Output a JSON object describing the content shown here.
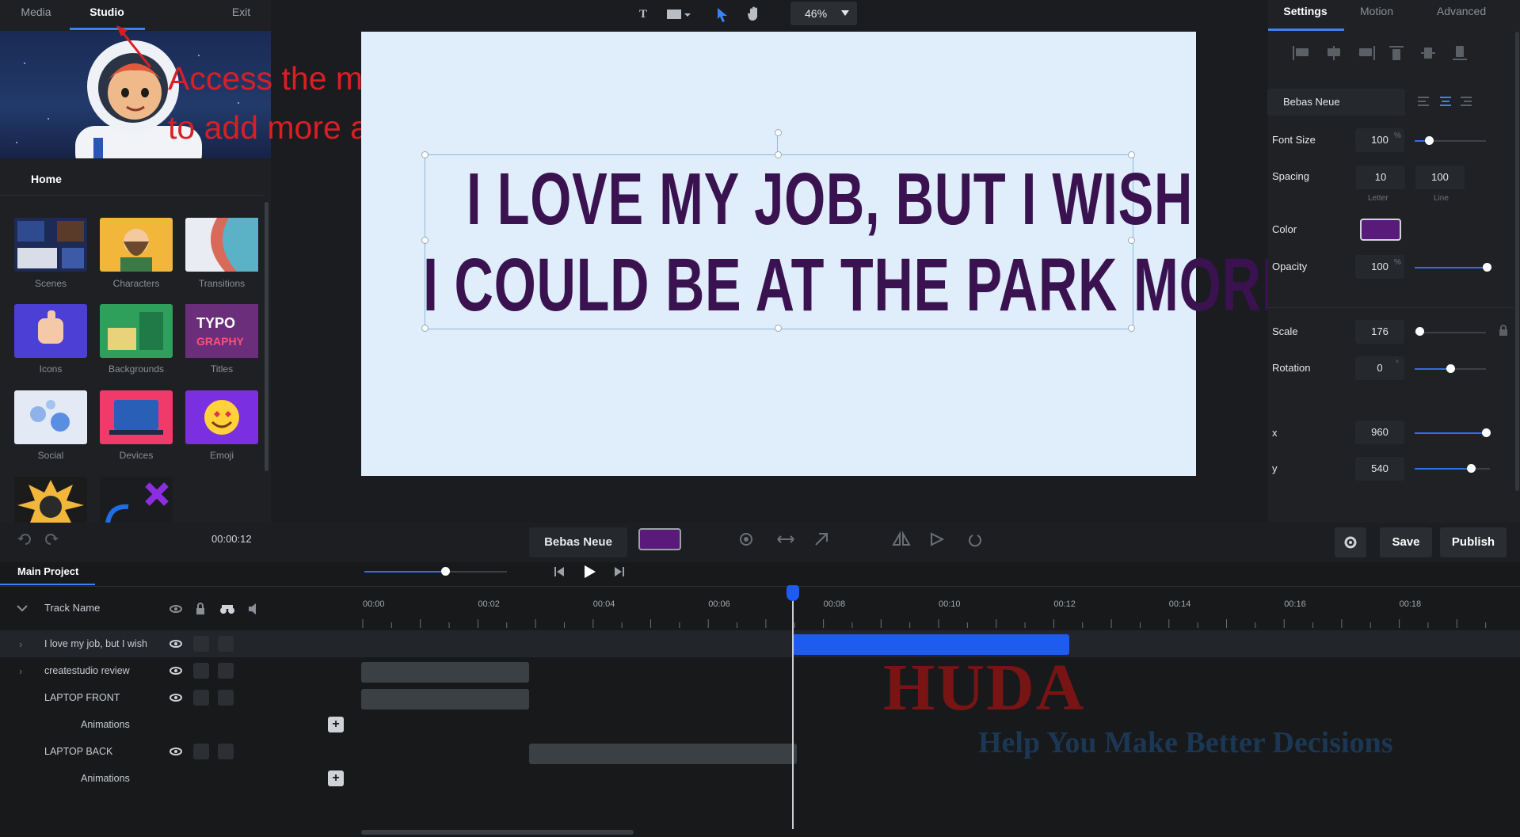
{
  "left_panel": {
    "tabs": [
      {
        "label": "Media",
        "active": false
      },
      {
        "label": "Studio",
        "active": true
      },
      {
        "label": "Exit",
        "active": false
      }
    ],
    "home_label": "Home",
    "categories": [
      {
        "label": "Scenes",
        "icon": "scenes-icon"
      },
      {
        "label": "Characters",
        "icon": "characters-icon"
      },
      {
        "label": "Transitions",
        "icon": "transitions-icon"
      },
      {
        "label": "Icons",
        "icon": "icons-icon"
      },
      {
        "label": "Backgrounds",
        "icon": "backgrounds-icon"
      },
      {
        "label": "Titles",
        "icon": "titles-icon"
      },
      {
        "label": "Social",
        "icon": "social-icon"
      },
      {
        "label": "Devices",
        "icon": "devices-icon"
      },
      {
        "label": "Emoji",
        "icon": "emoji-icon"
      }
    ],
    "thumb_typo_text": "TYPO GRAPHY"
  },
  "annotation": {
    "line1": "Access the media studio",
    "line2": "to add more animations."
  },
  "toolbar": {
    "text_tool": "T",
    "zoom": "46%"
  },
  "canvas": {
    "text_line1": "I LOVE MY JOB, BUT I WISH",
    "text_line2": "I COULD BE AT THE PARK MORE",
    "text_color": "#3a1250",
    "background_color": "#dfeefa"
  },
  "right_panel": {
    "tabs": [
      {
        "label": "Settings",
        "active": true
      },
      {
        "label": "Motion",
        "active": false
      },
      {
        "label": "Advanced",
        "active": false
      }
    ],
    "font_name": "Bebas Neue",
    "font_size_label": "Font Size",
    "font_size_value": "100",
    "font_size_unit": "%",
    "spacing_label": "Spacing",
    "spacing_letter": "10",
    "spacing_line": "100",
    "spacing_letter_sub": "Letter",
    "spacing_line_sub": "Line",
    "color_label": "Color",
    "color_value": "#5a1a7a",
    "opacity_label": "Opacity",
    "opacity_value": "100",
    "opacity_unit": "%",
    "scale_label": "Scale",
    "scale_value": "176",
    "rotation_label": "Rotation",
    "rotation_value": "0",
    "rotation_unit": "°",
    "x_label": "x",
    "x_value": "960",
    "y_label": "y",
    "y_value": "540"
  },
  "bottom_bar": {
    "time": "00:00:12",
    "font_name": "Bebas Neue",
    "swatch_color": "#5a1a7a",
    "save_label": "Save",
    "publish_label": "Publish"
  },
  "timeline": {
    "project_tab": "Main Project",
    "track_header": "Track Name",
    "ticks": [
      "00:00",
      "00:02",
      "00:04",
      "00:06",
      "00:08",
      "00:10",
      "00:12",
      "00:14",
      "00:16",
      "00:18"
    ],
    "tracks": [
      {
        "name": "I love my job, but I wish",
        "expandable": true
      },
      {
        "name": "createstudio review",
        "expandable": true
      },
      {
        "name": "LAPTOP FRONT",
        "expandable": false
      },
      {
        "name": "Animations",
        "sub": true
      },
      {
        "name": "LAPTOP BACK",
        "expandable": false
      },
      {
        "name": "Animations",
        "sub": true
      }
    ],
    "playhead_seconds": 7.5,
    "selected_clip": {
      "start": 7.5,
      "end": 12.3,
      "color": "#1e5cf0"
    }
  },
  "watermark": {
    "title": "HUDA",
    "subtitle": "Help You Make Better Decisions"
  }
}
